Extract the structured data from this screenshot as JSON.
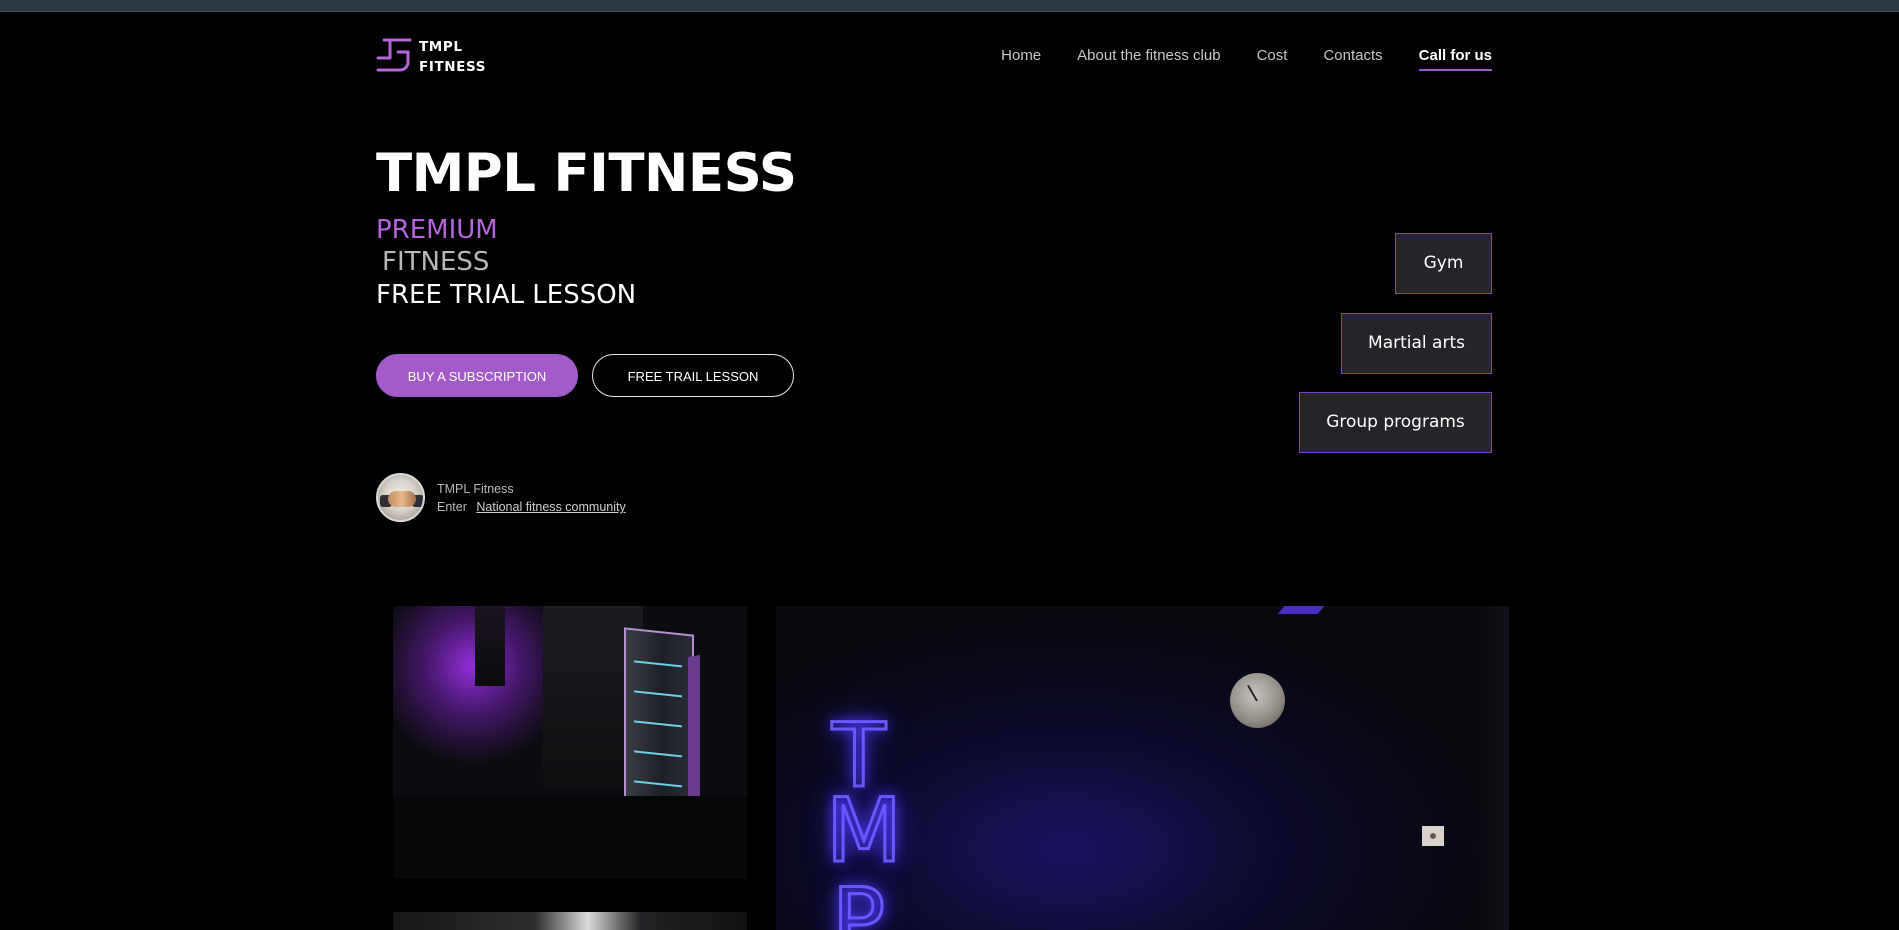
{
  "brand": {
    "logo_line1": "TMPL",
    "logo_line2": "FITNESS",
    "accent_color": "#a35bc9",
    "border_accent": "#7c3fd0"
  },
  "nav": {
    "items": [
      {
        "label": "Home"
      },
      {
        "label": "About the fitness club"
      },
      {
        "label": "Cost"
      },
      {
        "label": "Contacts"
      },
      {
        "label": "Call for us"
      }
    ]
  },
  "hero": {
    "title": "TMPL FITNESS",
    "line1": "PREMIUM",
    "line2": "FITNESS",
    "line3": "FREE TRIAL LESSON",
    "buy_button": "BUY A SUBSCRIPTION",
    "trial_button": "FREE TRAIL LESSON"
  },
  "community": {
    "name": "TMPL Fitness",
    "enter_label": "Enter",
    "link_label": "National fitness community"
  },
  "categories": [
    {
      "label": "Gym"
    },
    {
      "label": "Martial arts"
    },
    {
      "label": "Group programs"
    }
  ],
  "gallery": {
    "neon_letters": [
      "T",
      "M",
      "P"
    ]
  }
}
